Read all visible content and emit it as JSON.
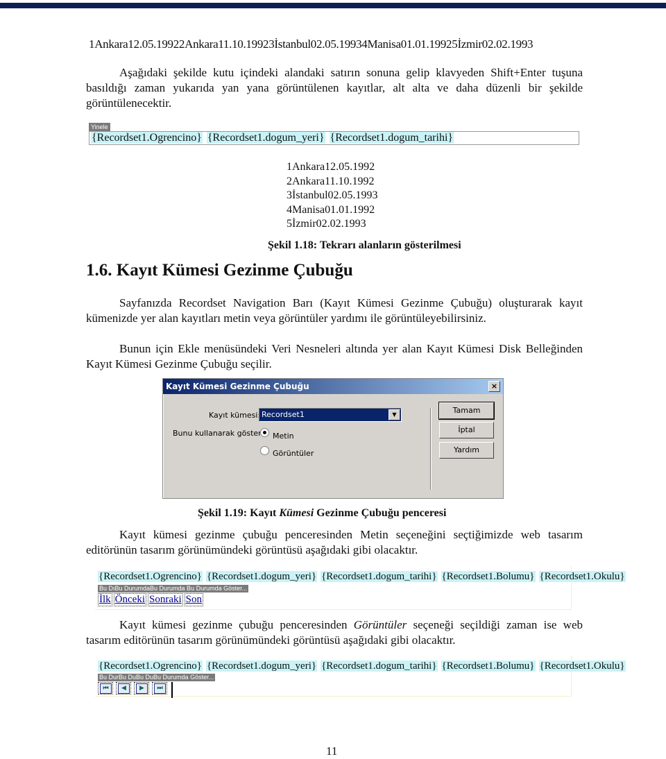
{
  "top_line": "1Ankara12.05.19922Ankara11.10.19923İstanbul02.05.19934Manisa01.01.19925İzmir02.02.1993",
  "para1": "Aşağıdaki şekilde kutu içindeki alandaki satırın sonuna gelip klavyeden Shift+Enter tuşuna basıldığı zaman yukarıda yan yana görüntülenen kayıtlar, alt alta ve daha düzenli bir şekilde görüntülenecektir.",
  "repeat_region": {
    "label": "Yinele",
    "fields": [
      "{Recordset1.Ogrencino}",
      "{Recordset1.dogum_yeri}",
      "{Recordset1.dogum_tarihi}"
    ]
  },
  "records": [
    "1Ankara12.05.1992",
    "2Ankara11.10.1992",
    "3İstanbul02.05.1993",
    "4Manisa01.01.1992",
    "5İzmir02.02.1993"
  ],
  "caption1": "Şekil 1.18: Tekrarı alanların gösterilmesi",
  "heading": "1.6. Kayıt Kümesi Gezinme Çubuğu",
  "para2": "Sayfanızda Recordset Navigation Barı (Kayıt Kümesi Gezinme Çubuğu) oluşturarak kayıt kümenizde yer alan kayıtları metin veya görüntüler yardımı ile görüntüleyebilirsiniz.",
  "para3": "Bunun için Ekle menüsündeki Veri Nesneleri altında yer alan Kayıt Kümesi Disk Belleğinden Kayıt Kümesi Gezinme Çubuğu seçilir.",
  "dialog": {
    "title": "Kayıt Kümesi Gezinme Çubuğu",
    "close_label": "×",
    "recordset_label": "Kayıt kümesi:",
    "recordset_value": "Recordset1",
    "dropdown_arrow": "▼",
    "show_label": "Bunu kullanarak göster:",
    "radio_text": "Metin",
    "radio_text_checked": true,
    "radio_images": "Görüntüler",
    "radio_images_checked": false,
    "ok": "Tamam",
    "cancel": "İptal",
    "help": "Yardım",
    "title_gradient": [
      "#0a246a",
      "#a6caf0"
    ],
    "face_color": "#d6d3ce"
  },
  "caption2_pre": "Şekil 1.19: Kayıt ",
  "caption2_italic": "Kümesi",
  "caption2_post": " Gezinme Çubuğu penceresi",
  "para4": "Kayıt kümesi gezinme çubuğu penceresinden Metin seçeneğini seçtiğimizde web tasarım editörünün tasarım görünümündeki görüntüsü aşağıdaki gibi olacaktır.",
  "design_view_fields": [
    "{Recordset1.Ogrencino}",
    "{Recordset1.dogum_yeri}",
    "{Recordset1.dogum_tarihi}",
    "{Recordset1.Bolumu}",
    "{Recordset1.Okulu}"
  ],
  "text_nav": {
    "tab_label": "Bu DıBu DurumdaBu Durumda Bu Durumda Göster...",
    "links": [
      "İlk",
      "Önceki",
      "Sonraki",
      "Son"
    ]
  },
  "para5_pre": "Kayıt kümesi gezinme çubuğu penceresinden ",
  "para5_italic": "Görüntüler",
  "para5_post": " seçeneği seçildiği zaman ise web tasarım editörünün tasarım görünümündeki görüntüsü aşağıdaki gibi olacaktır.",
  "image_nav": {
    "tab_label": "Bu DurBu DuBu DuBu Durumda Göster...",
    "buttons": [
      {
        "icon": "first-icon",
        "glyph": "⏮"
      },
      {
        "icon": "previous-icon",
        "glyph": "◀"
      },
      {
        "icon": "next-icon",
        "glyph": "▶"
      },
      {
        "icon": "last-icon",
        "glyph": "⏭"
      }
    ]
  },
  "page_number": "11"
}
